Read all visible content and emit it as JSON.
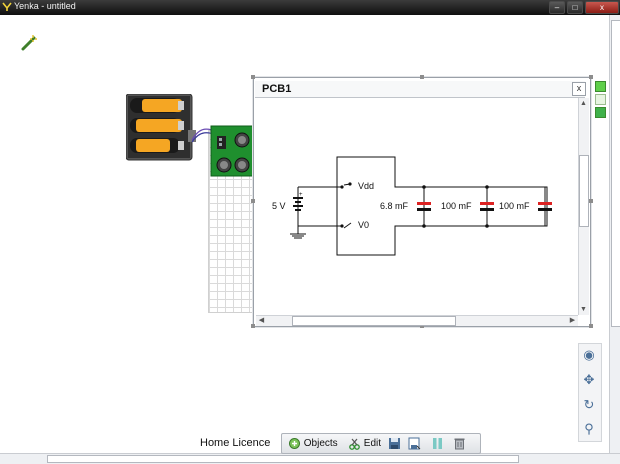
{
  "window": {
    "title": "Yenka - untitled",
    "min_label": "–",
    "max_label": "□",
    "close_label": "x"
  },
  "pcb": {
    "title": "PCB1",
    "close_label": "x",
    "circuit": {
      "battery_label": "5 V",
      "vdd_label": "Vdd",
      "v0_label": "V0",
      "capacitors": [
        "6.8 mF",
        "100 mF",
        "100 mF"
      ]
    }
  },
  "bottom": {
    "licence": "Home Licence",
    "objects_label": "Objects",
    "edit_label": "Edit"
  },
  "colors": {
    "accent": "#4a6f98",
    "battery": "#f5a623",
    "pcb_board": "#1f8f2e",
    "titlebar": "#1a1a1a"
  },
  "icons": {
    "toolbar": [
      "objects-icon",
      "edit-icon",
      "save-icon",
      "save-as-icon",
      "pause-icon",
      "trash-icon"
    ],
    "side": [
      "eye-icon",
      "move-icon",
      "rotate-icon",
      "zoom-icon"
    ]
  }
}
